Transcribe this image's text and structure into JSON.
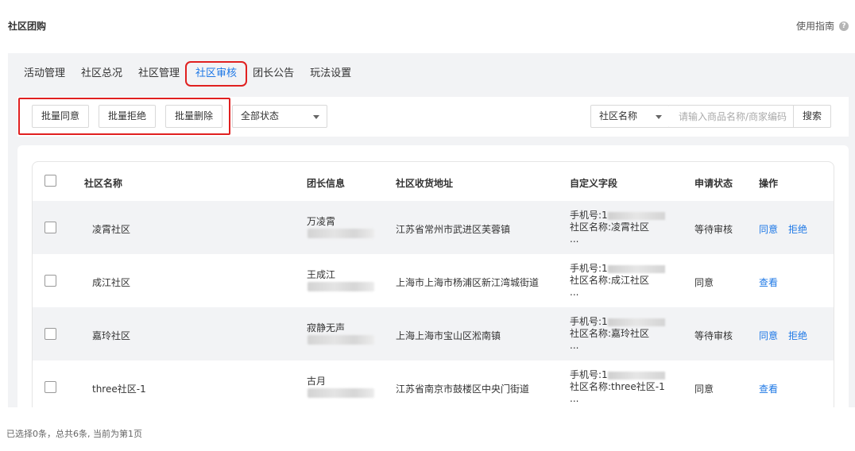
{
  "header": {
    "title": "社区团购",
    "guide_label": "使用指南",
    "help_icon": "question-circle-icon"
  },
  "tabs": [
    {
      "label": "活动管理",
      "active": false
    },
    {
      "label": "社区总况",
      "active": false
    },
    {
      "label": "社区管理",
      "active": false
    },
    {
      "label": "社区审核",
      "active": true
    },
    {
      "label": "团长公告",
      "active": false
    },
    {
      "label": "玩法设置",
      "active": false
    }
  ],
  "toolbar": {
    "bulk_approve": "批量同意",
    "bulk_reject": "批量拒绝",
    "bulk_delete": "批量删除",
    "status_select": "全部状态",
    "field_select": "社区名称",
    "search_placeholder": "请输入商品名称/商家编码",
    "search_button": "搜索"
  },
  "table": {
    "headers": {
      "community": "社区名称",
      "leader": "团长信息",
      "address": "社区收货地址",
      "custom": "自定义字段",
      "status": "申请状态",
      "action": "操作"
    },
    "rows": [
      {
        "community": "凌霄社区",
        "leader": "万凌霄",
        "address": "江苏省常州市武进区芙蓉镇",
        "phone_label": "手机号:1",
        "custom_name": "社区名称:凌霄社区",
        "ellipsis": "...",
        "status": "等待审核",
        "actions": [
          "同意",
          "拒绝"
        ]
      },
      {
        "community": "成江社区",
        "leader": "王成江",
        "address": "上海市上海市杨浦区新江湾城街道",
        "phone_label": "手机号:1",
        "custom_name": "社区名称:成江社区",
        "ellipsis": "...",
        "status": "同意",
        "actions": [
          "查看"
        ]
      },
      {
        "community": "嘉玲社区",
        "leader": "寂静无声",
        "address": "上海上海市宝山区淞南镇",
        "phone_label": "手机号:1",
        "custom_name": "社区名称:嘉玲社区",
        "ellipsis": "...",
        "status": "等待审核",
        "actions": [
          "同意",
          "拒绝"
        ]
      },
      {
        "community": "three社区-1",
        "leader": "古月",
        "address": "江苏省南京市鼓楼区中央门街道",
        "phone_label": "手机号:1",
        "custom_name": "社区名称:three社区-1",
        "ellipsis": "...",
        "status": "同意",
        "actions": [
          "查看"
        ]
      }
    ]
  },
  "footer": {
    "summary": "已选择0条，总共6条, 当前为第1页"
  },
  "colors": {
    "accent": "#1e78e6",
    "highlight_border": "#e02020",
    "panel_bg": "#f2f3f5"
  }
}
